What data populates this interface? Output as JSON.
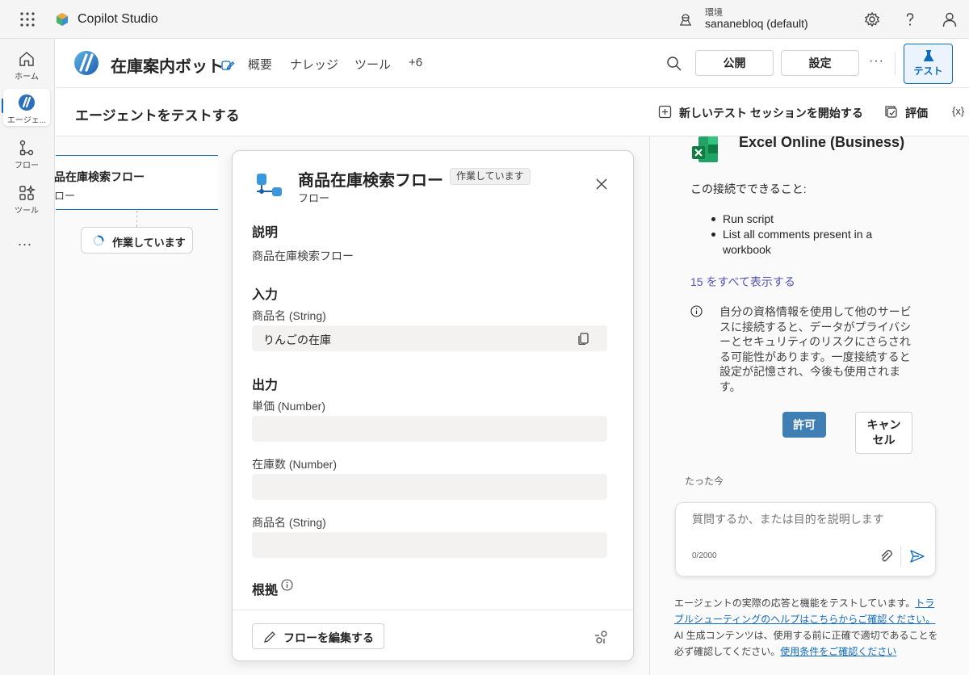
{
  "topbar": {
    "app_name": "Copilot Studio",
    "env_label": "環境",
    "env_value": "sananebloq (default)",
    "icons": [
      "waffle-icon",
      "environment-icon",
      "settings-icon",
      "help-icon",
      "account-icon"
    ]
  },
  "rail": {
    "items": [
      {
        "label": "ホーム",
        "icon": "home-icon"
      },
      {
        "label": "エージェ...",
        "icon": "agent-icon",
        "active": true
      },
      {
        "label": "フロー",
        "icon": "flow-icon"
      },
      {
        "label": "ツール",
        "icon": "tools-icon"
      }
    ],
    "more": "..."
  },
  "agent_header": {
    "name": "在庫案内ボット",
    "tabs": [
      "概要",
      "ナレッジ",
      "ツール",
      "+6"
    ],
    "publish": "公開",
    "settings": "設定",
    "more": "···",
    "test": "テスト"
  },
  "subheader": {
    "title": "エージェントをテストする",
    "new_session": "新しいテスト セッションを開始する",
    "evaluate": "評価",
    "variables": "{x}"
  },
  "canvas": {
    "node_title": "品在庫検索フロー",
    "node_sub": "ロー",
    "working": "作業しています"
  },
  "card": {
    "title": "商品在庫検索フロー",
    "status": "作業しています",
    "subtitle": "フロー",
    "description_h": "説明",
    "description": "商品在庫検索フロー",
    "inputs_h": "入力",
    "inputs": [
      {
        "label": "商品名 (String)",
        "value": "りんごの在庫"
      }
    ],
    "outputs_h": "出力",
    "outputs": [
      {
        "label": "単価 (Number)",
        "value": ""
      },
      {
        "label": "在庫数 (Number)",
        "value": ""
      },
      {
        "label": "商品名 (String)",
        "value": ""
      }
    ],
    "rationale_h": "根拠",
    "edit_flow": "フローを編集する"
  },
  "chat": {
    "connector_name": "Excel Online (Business)",
    "capabilities_h": "この接続でできること:",
    "capabilities": [
      "Run script",
      "List all comments present in a workbook"
    ],
    "show_all": "15 をすべて表示する",
    "warning": "自分の資格情報を使用して他のサービスに接続すると、データがプライバシーとセキュリティのリスクにさらされる可能性があります。一度接続すると設定が記憶され、今後も使用されます。",
    "allow": "許可",
    "cancel": "キャンセル",
    "timestamp": "たった今",
    "input_placeholder": "質問するか、または目的を説明します",
    "counter": "0/2000",
    "disclaimer_1": "エージェントの実際の応答と機能をテストしています。",
    "disclaimer_link1": "トラブルシューティングのヘルプはこちらからご確認ください。",
    "disclaimer_2": "AI 生成コンテンツは、使用する前に正確で適切であることを必ず確認してください。",
    "disclaimer_link2": "使用条件をご確認ください"
  },
  "colors": {
    "accent": "#0f6cbd",
    "allow_button": "#3f7fb3",
    "link": "#4f52b2"
  }
}
